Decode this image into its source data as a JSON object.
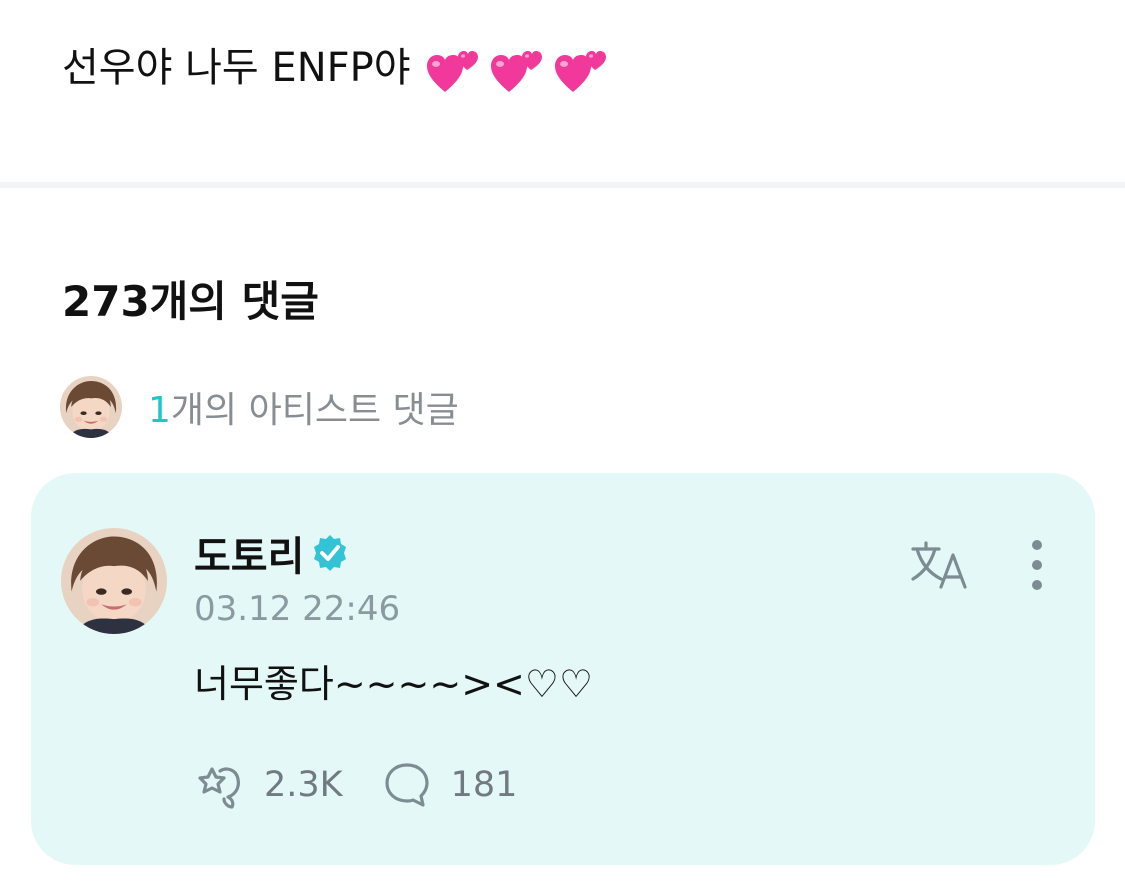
{
  "post": {
    "text": "선우야 나두 ENFP야",
    "emoji_icon": "two-hearts-emoji",
    "emoji_count": 3
  },
  "comments": {
    "count_label": "273개의 댓글",
    "artist": {
      "number": "1",
      "label": "개의 아티스트 댓글"
    }
  },
  "comment": {
    "author": "도토리",
    "verified_icon": "verified-badge-icon",
    "timestamp": "03.12 22:46",
    "body": "너무좋다~~~~><♡♡",
    "translate_icon": "translate-icon",
    "more_icon": "more-vertical-icon",
    "likes": "2.3K",
    "replies": "181"
  },
  "colors": {
    "accent": "#1fc8c8",
    "card_bg": "#e4f8f7",
    "muted_text": "#888d93",
    "icon_gray": "#7d8c92",
    "heart_pink": "#f0399a"
  }
}
